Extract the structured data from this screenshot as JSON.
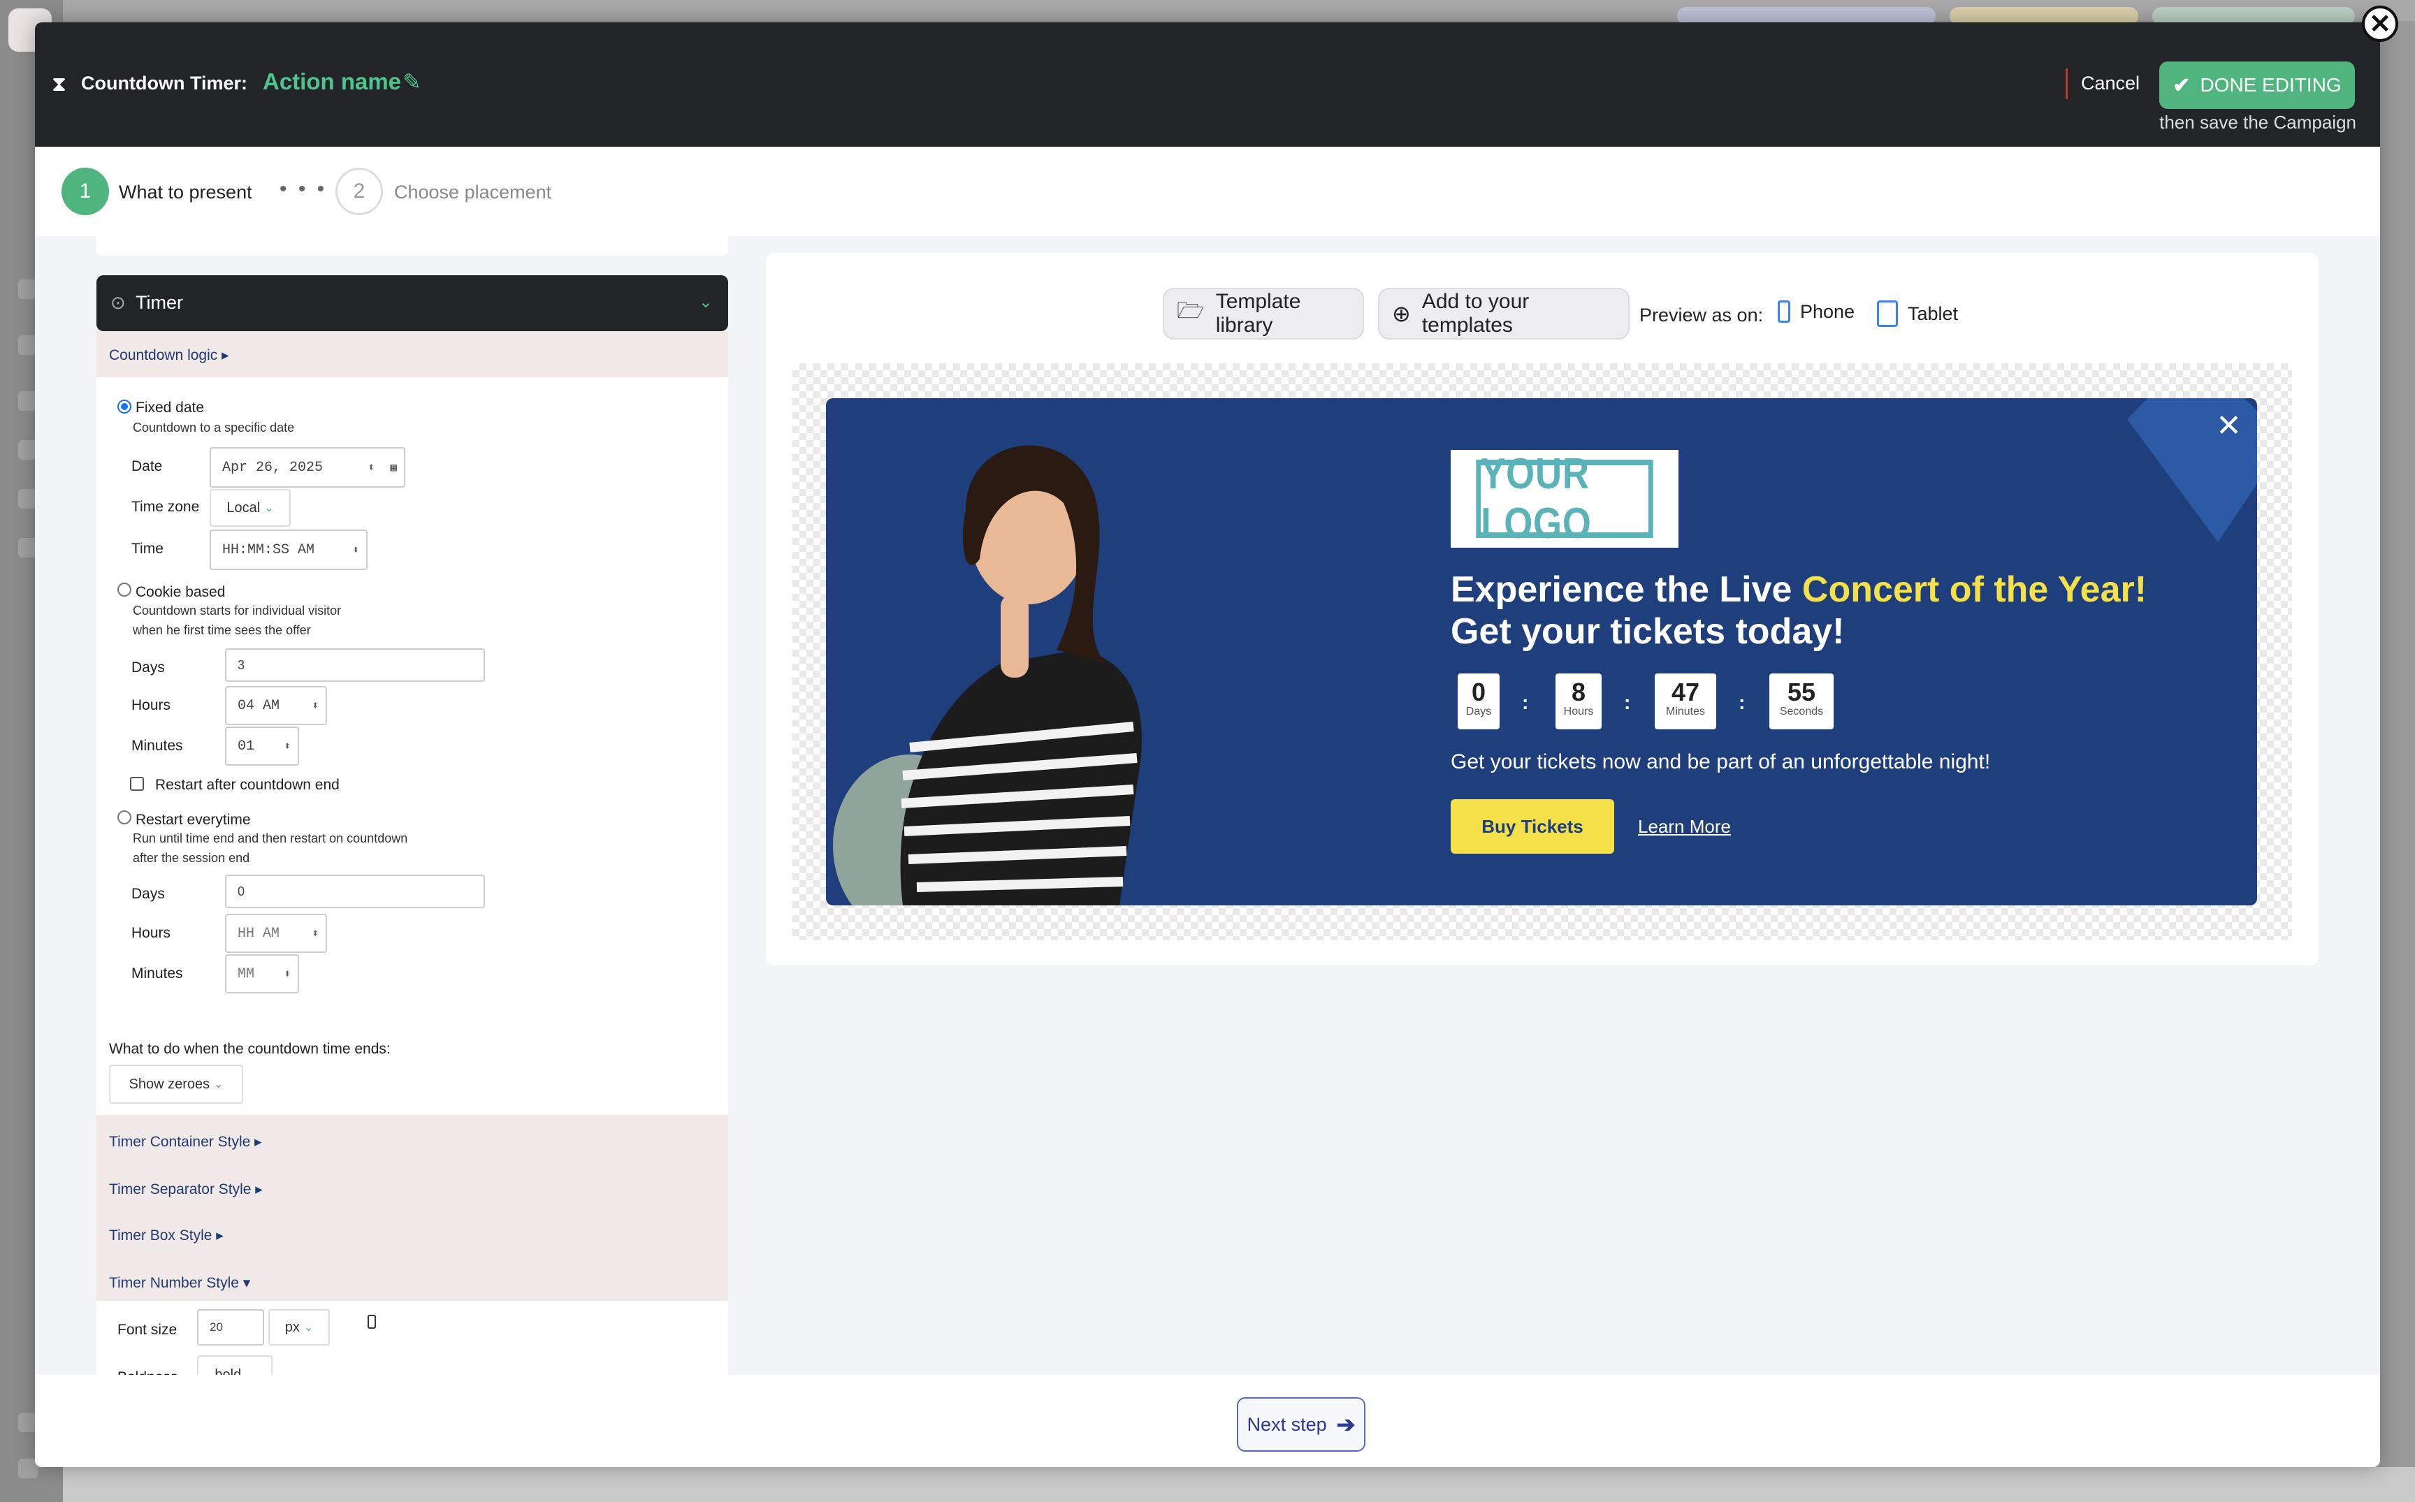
{
  "modal": {
    "header": {
      "label": "Countdown Timer:",
      "action_name": "Action name",
      "cancel": "Cancel",
      "done": "DONE EDITING",
      "done_hint": "then save the Campaign"
    },
    "steps": [
      {
        "number": "1",
        "label": "What to present"
      },
      {
        "number": "2",
        "label": "Choose placement"
      }
    ],
    "steps_dots": "• • •"
  },
  "panel": {
    "timer_title": "Timer",
    "countdown_logic": "Countdown logic ▸",
    "fixed": {
      "label": "Fixed date",
      "desc": "Countdown to a specific date",
      "date_label": "Date",
      "date_value": "Apr 26, 2025",
      "tz_label": "Time zone",
      "tz_value": "Local",
      "time_label": "Time",
      "time_value": "HH:MM:SS AM"
    },
    "cookie": {
      "label": "Cookie based",
      "desc1": "Countdown starts for individual visitor",
      "desc2": "when he first time sees the offer",
      "days_label": "Days",
      "days_value": "3",
      "hours_label": "Hours",
      "hours_value": "04 AM",
      "minutes_label": "Minutes",
      "minutes_value": "01",
      "restart_label": "Restart after countdown end"
    },
    "restart": {
      "label": "Restart everytime",
      "desc1": "Run until time end and then restart on countdown",
      "desc2": "after the session end",
      "days_label": "Days",
      "days_value": "0",
      "hours_label": "Hours",
      "hours_value": "HH AM",
      "minutes_label": "Minutes",
      "minutes_value": "MM"
    },
    "end_action_label": "What to do when the countdown time ends:",
    "end_action_value": "Show zeroes",
    "style_sections": [
      "Timer Container Style ▸",
      "Timer Separator Style ▸",
      "Timer Box Style ▸",
      "Timer Number Style ▾"
    ],
    "font_size_label": "Font size",
    "font_size_value": "20",
    "font_unit": "px",
    "boldness_label": "Boldness",
    "boldness_value": "bold"
  },
  "preview": {
    "template_library": "Template library",
    "add_templates": "Add to your templates",
    "preview_as": "Preview as on:",
    "phone": "Phone",
    "tablet": "Tablet",
    "banner": {
      "logo_text": "YOUR LOGO",
      "headline_1a": "Experience the Live ",
      "headline_1b": "Concert of the Year!",
      "headline_2": "Get your tickets today!",
      "countdown": [
        {
          "value": "0",
          "unit": "Days"
        },
        {
          "value": "8",
          "unit": "Hours"
        },
        {
          "value": "47",
          "unit": "Minutes"
        },
        {
          "value": "55",
          "unit": "Seconds"
        }
      ],
      "separator": ":",
      "subtext": "Get your tickets now and be part of an unforgettable night!",
      "buy": "Buy Tickets",
      "learn": "Learn More"
    }
  },
  "footer": {
    "next": "Next step"
  },
  "colors": {
    "accent_green": "#4fb47e",
    "banner_blue": "#1f3e7c",
    "highlight_yellow": "#f4e14a",
    "header_dark": "#232428"
  }
}
